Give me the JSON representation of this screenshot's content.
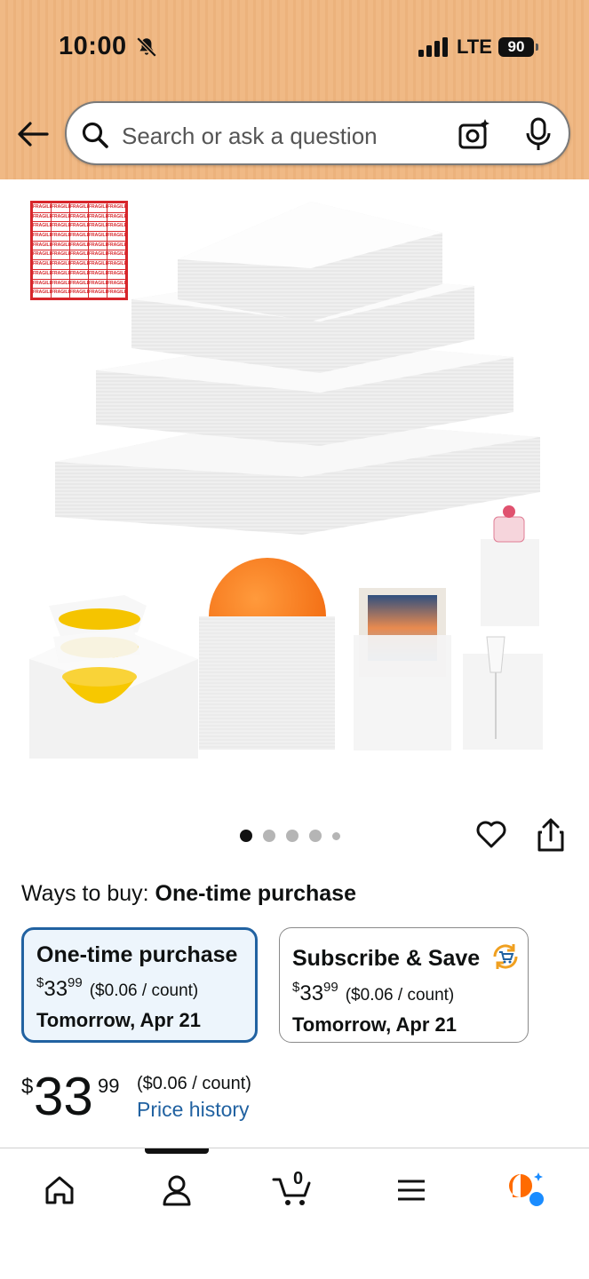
{
  "status_bar": {
    "time": "10:00",
    "network": "LTE",
    "battery": "90"
  },
  "search": {
    "placeholder": "Search or ask a question"
  },
  "product_image": {
    "sticker_text": "FRAGILE",
    "carousel": {
      "total": 5,
      "active": 1
    }
  },
  "ways_to_buy": {
    "label": "Ways to buy:",
    "selected": "One-time purchase"
  },
  "options": [
    {
      "title": "One-time purchase",
      "currency": "$",
      "whole": "33",
      "cents": "99",
      "unit": "($0.06 / count)",
      "delivery": "Tomorrow, Apr 21",
      "selected": true
    },
    {
      "title": "Subscribe & Save",
      "currency": "$",
      "whole": "33",
      "cents": "99",
      "unit": "($0.06 / count)",
      "delivery": "Tomorrow, Apr 21",
      "selected": false
    }
  ],
  "price": {
    "currency": "$",
    "whole": "33",
    "cents": "99",
    "unit": "($0.06 / count)",
    "history_link": "Price history"
  },
  "nav": {
    "cart_count": "0"
  },
  "colors": {
    "header": "#f0b985",
    "link": "#2162a1",
    "selected_border": "#2162a1",
    "selected_bg": "#edf5fc",
    "alexa_orange": "#ff6b00",
    "alexa_blue": "#1a8cff"
  }
}
